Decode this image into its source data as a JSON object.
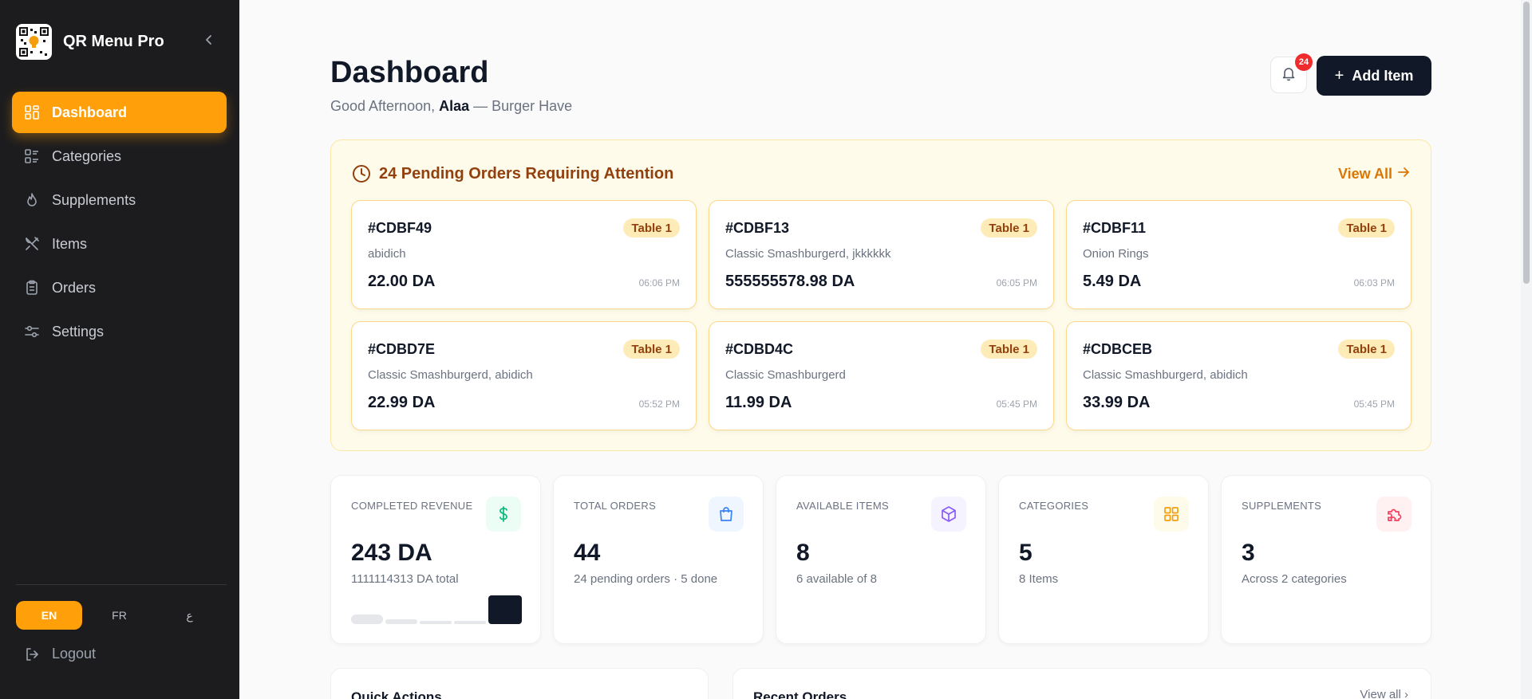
{
  "sidebar": {
    "brand": "QR Menu Pro",
    "items": [
      {
        "label": "Dashboard",
        "icon": "dashboard-icon"
      },
      {
        "label": "Categories",
        "icon": "categories-icon"
      },
      {
        "label": "Supplements",
        "icon": "flame-icon"
      },
      {
        "label": "Items",
        "icon": "utensils-icon"
      },
      {
        "label": "Orders",
        "icon": "clipboard-icon"
      },
      {
        "label": "Settings",
        "icon": "sliders-icon"
      }
    ],
    "languages": [
      "EN",
      "FR",
      "ع"
    ],
    "logout": "Logout"
  },
  "header": {
    "title": "Dashboard",
    "greeting_prefix": "Good Afternoon, ",
    "user": "Alaa",
    "greeting_suffix": " — Burger Have",
    "notification_count": "24",
    "add_item": "Add Item"
  },
  "pending": {
    "title": "24 Pending Orders Requiring Attention",
    "view_all": "View All",
    "orders": [
      {
        "id": "#CDBF49",
        "table": "Table 1",
        "items": "abidich",
        "price": "22.00 DA",
        "time": "06:06 PM"
      },
      {
        "id": "#CDBF13",
        "table": "Table 1",
        "items": "Classic Smashburgerd, jkkkkkk",
        "price": "555555578.98 DA",
        "time": "06:05 PM"
      },
      {
        "id": "#CDBF11",
        "table": "Table 1",
        "items": "Onion Rings",
        "price": "5.49 DA",
        "time": "06:03 PM"
      },
      {
        "id": "#CDBD7E",
        "table": "Table 1",
        "items": "Classic Smashburgerd, abidich",
        "price": "22.99 DA",
        "time": "05:52 PM"
      },
      {
        "id": "#CDBD4C",
        "table": "Table 1",
        "items": "Classic Smashburgerd",
        "price": "11.99 DA",
        "time": "05:45 PM"
      },
      {
        "id": "#CDBCEB",
        "table": "Table 1",
        "items": "Classic Smashburgerd, abidich",
        "price": "33.99 DA",
        "time": "05:45 PM"
      }
    ]
  },
  "stats": [
    {
      "label": "COMPLETED REVENUE",
      "value": "243 DA",
      "sub": "1111114313 DA total",
      "icon": "dollar-icon",
      "color": "#10b981",
      "bg": "#ecfdf5"
    },
    {
      "label": "TOTAL ORDERS",
      "value": "44",
      "sub": "24 pending orders · 5 done",
      "icon": "shopping-bag-icon",
      "color": "#3b82f6",
      "bg": "#eff6ff"
    },
    {
      "label": "AVAILABLE ITEMS",
      "value": "8",
      "sub": "6 available of 8",
      "icon": "package-icon",
      "color": "#8b5cf6",
      "bg": "#f5f3ff"
    },
    {
      "label": "CATEGORIES",
      "value": "5",
      "sub": "8 Items",
      "icon": "grid-icon",
      "color": "#f59e0b",
      "bg": "#fffbeb"
    },
    {
      "label": "SUPPLEMENTS",
      "value": "3",
      "sub": "Across 2 categories",
      "icon": "puzzle-icon",
      "color": "#f43f5e",
      "bg": "#fff1f2"
    }
  ],
  "bottom": {
    "quick_actions": "Quick Actions",
    "recent_orders": "Recent Orders",
    "view_all": "View all"
  },
  "colors": {
    "accent": "#ff9f0a",
    "sidebar": "#1c1c1e",
    "dark": "#111827"
  }
}
